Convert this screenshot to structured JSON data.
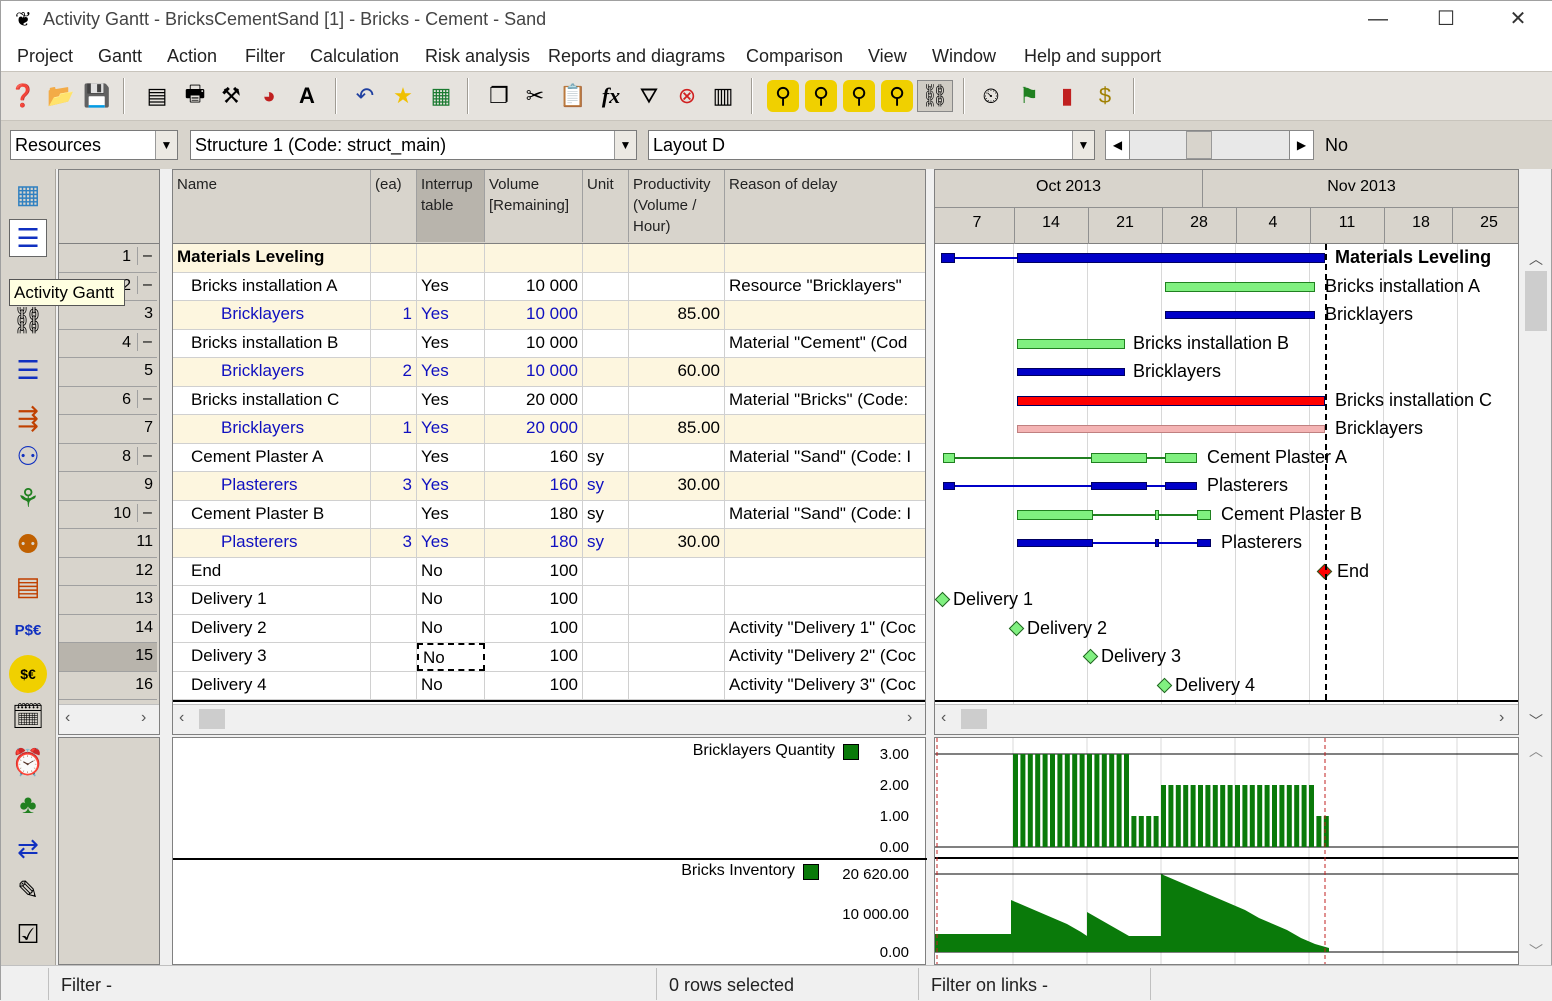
{
  "window": {
    "title": "Activity Gantt - BricksCementSand [1] - Bricks - Cement - Sand",
    "minimize_glyph": "—",
    "maximize_glyph": "☐",
    "close_glyph": "✕"
  },
  "menu": [
    "Project",
    "Gantt",
    "Action",
    "Filter",
    "Calculation",
    "Risk analysis",
    "Reports and diagrams",
    "Comparison",
    "View",
    "Window",
    "Help and support"
  ],
  "combos": {
    "view": "Resources",
    "structure": "Structure 1 (Code: struct_main)",
    "layout": "Layout D",
    "slider_value": "No"
  },
  "tooltip": "Activity Gantt",
  "grid": {
    "headers": {
      "name": "Name",
      "ea": "(ea)",
      "interruptable": "Interrup table",
      "volume": "Volume [Remaining]",
      "unit": "Unit",
      "productivity": "Productivity (Volume / Hour)",
      "reason": "Reason of delay"
    },
    "group_title": "Materials Leveling",
    "rows": [
      {
        "num": "1",
        "name": "Materials Leveling",
        "type": "group"
      },
      {
        "num": "2",
        "name": "Bricks installation A",
        "ea": "",
        "int": "Yes",
        "vol": "10 000",
        "unit": "",
        "prod": "",
        "reason": "Resource \"Bricklayers\"",
        "type": "act"
      },
      {
        "num": "3",
        "name": "Bricklayers",
        "ea": "1",
        "int": "Yes",
        "vol": "10 000",
        "unit": "",
        "prod": "85.00",
        "reason": "",
        "type": "res"
      },
      {
        "num": "4",
        "name": "Bricks installation B",
        "ea": "",
        "int": "Yes",
        "vol": "10 000",
        "unit": "",
        "prod": "",
        "reason": "Material \"Cement\" (Cod",
        "type": "act"
      },
      {
        "num": "5",
        "name": "Bricklayers",
        "ea": "2",
        "int": "Yes",
        "vol": "10 000",
        "unit": "",
        "prod": "60.00",
        "reason": "",
        "type": "res"
      },
      {
        "num": "6",
        "name": "Bricks installation C",
        "ea": "",
        "int": "Yes",
        "vol": "20 000",
        "unit": "",
        "prod": "",
        "reason": "Material \"Bricks\" (Code:",
        "type": "act"
      },
      {
        "num": "7",
        "name": "Bricklayers",
        "ea": "1",
        "int": "Yes",
        "vol": "20 000",
        "unit": "",
        "prod": "85.00",
        "reason": "",
        "type": "res"
      },
      {
        "num": "8",
        "name": "Cement Plaster A",
        "ea": "",
        "int": "Yes",
        "vol": "160",
        "unit": "sy",
        "prod": "",
        "reason": "Material \"Sand\" (Code: I",
        "type": "act"
      },
      {
        "num": "9",
        "name": "Plasterers",
        "ea": "3",
        "int": "Yes",
        "vol": "160",
        "unit": "sy",
        "prod": "30.00",
        "reason": "",
        "type": "res"
      },
      {
        "num": "10",
        "name": "Cement Plaster B",
        "ea": "",
        "int": "Yes",
        "vol": "180",
        "unit": "sy",
        "prod": "",
        "reason": "Material \"Sand\" (Code: I",
        "type": "act"
      },
      {
        "num": "11",
        "name": "Plasterers",
        "ea": "3",
        "int": "Yes",
        "vol": "180",
        "unit": "sy",
        "prod": "30.00",
        "reason": "",
        "type": "res"
      },
      {
        "num": "12",
        "name": "End",
        "ea": "",
        "int": "No",
        "vol": "100",
        "unit": "",
        "prod": "",
        "reason": "",
        "type": "act"
      },
      {
        "num": "13",
        "name": "Delivery 1",
        "ea": "",
        "int": "No",
        "vol": "100",
        "unit": "",
        "prod": "",
        "reason": "",
        "type": "act"
      },
      {
        "num": "14",
        "name": "Delivery 2",
        "ea": "",
        "int": "No",
        "vol": "100",
        "unit": "",
        "prod": "",
        "reason": "Activity \"Delivery 1\" (Coc",
        "type": "act"
      },
      {
        "num": "15",
        "name": "Delivery 3",
        "ea": "",
        "int": "No",
        "vol": "100",
        "unit": "",
        "prod": "",
        "reason": "Activity \"Delivery 2\" (Coc",
        "type": "act"
      },
      {
        "num": "16",
        "name": "Delivery 4",
        "ea": "",
        "int": "No",
        "vol": "100",
        "unit": "",
        "prod": "",
        "reason": "Activity \"Delivery 3\" (Coc",
        "type": "act"
      }
    ]
  },
  "timeline": {
    "months": [
      "Oct 2013",
      "Nov 2013"
    ],
    "days": [
      "7",
      "14",
      "21",
      "28",
      "4",
      "11",
      "18",
      "25"
    ]
  },
  "gantt_labels": [
    "Materials Leveling",
    "Bricks installation A",
    "Bricklayers",
    "Bricks installation B",
    "Bricklayers",
    "Bricks installation C",
    "Bricklayers",
    "Cement Plaster A",
    "Plasterers",
    "Cement Plaster B",
    "Plasterers",
    "End",
    "Delivery 1",
    "Delivery 2",
    "Delivery 3",
    "Delivery 4"
  ],
  "histograms": {
    "top_title": "Bricklayers Quantity",
    "top_ticks": [
      "3.00",
      "2.00",
      "1.00",
      "0.00"
    ],
    "bottom_title": "Bricks Inventory",
    "bottom_ticks": [
      "20 620.00",
      "10 000.00",
      "0.00"
    ],
    "colors": {
      "green": "#0a7a0a",
      "dark_blue": "#0000c8",
      "light_green": "#80f080",
      "red": "#ff0000",
      "pink": "#f4b4b4"
    }
  },
  "status": {
    "filter": "Filter -",
    "rows_selected": "0 rows selected",
    "filter_links": "Filter on links -"
  }
}
